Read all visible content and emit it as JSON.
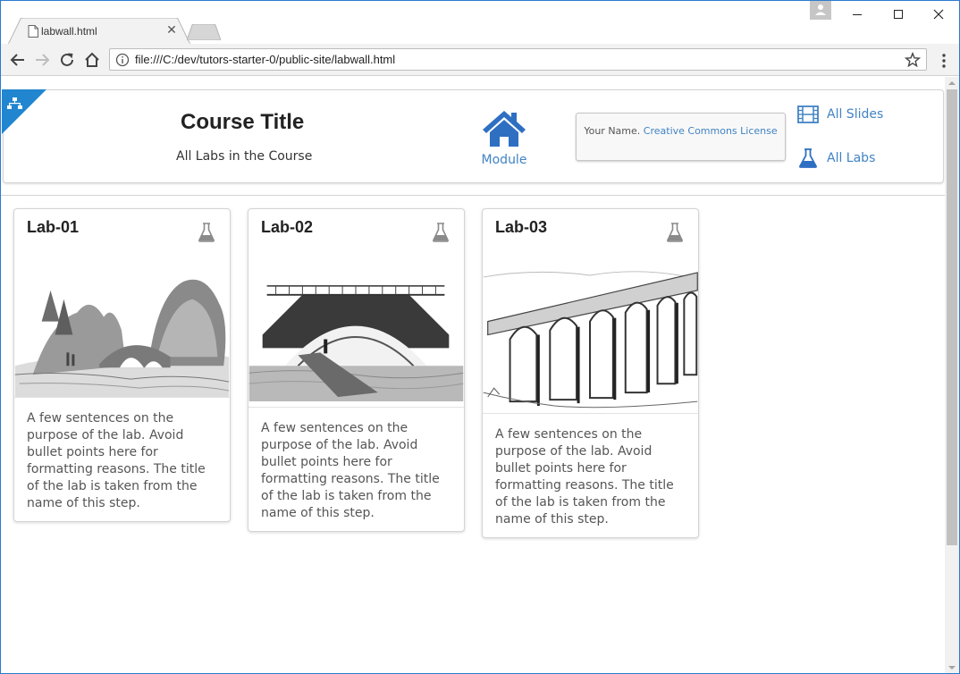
{
  "browser": {
    "tab_title": "labwall.html",
    "url": "file:///C:/dev/tutors-starter-0/public-site/labwall.html",
    "accent": "#2b7bd0"
  },
  "header": {
    "course_title": "Course Title",
    "course_subtitle": "All Labs in the Course",
    "module_label": "Module",
    "license_author": "Your Name.",
    "license_link": "Creative Commons License",
    "all_slides": "All Slides",
    "all_labs": "All Labs",
    "link_color": "#4183c4"
  },
  "labs": [
    {
      "title": "Lab-01",
      "image": "stone-bridge-landscape",
      "description": "A few sentences on the purpose of the lab. Avoid bullet points here for formatting reasons. The title of the lab is taken from the name of this step."
    },
    {
      "title": "Lab-02",
      "image": "arched-bridge-over-water",
      "description": "A few sentences on the purpose of the lab. Avoid bullet points here for formatting reasons. The title of the lab is taken from the name of this step."
    },
    {
      "title": "Lab-03",
      "image": "viaduct-sketch",
      "description": "A few sentences on the purpose of the lab. Avoid bullet points here for formatting reasons. The title of the lab is taken from the name of this step."
    }
  ]
}
